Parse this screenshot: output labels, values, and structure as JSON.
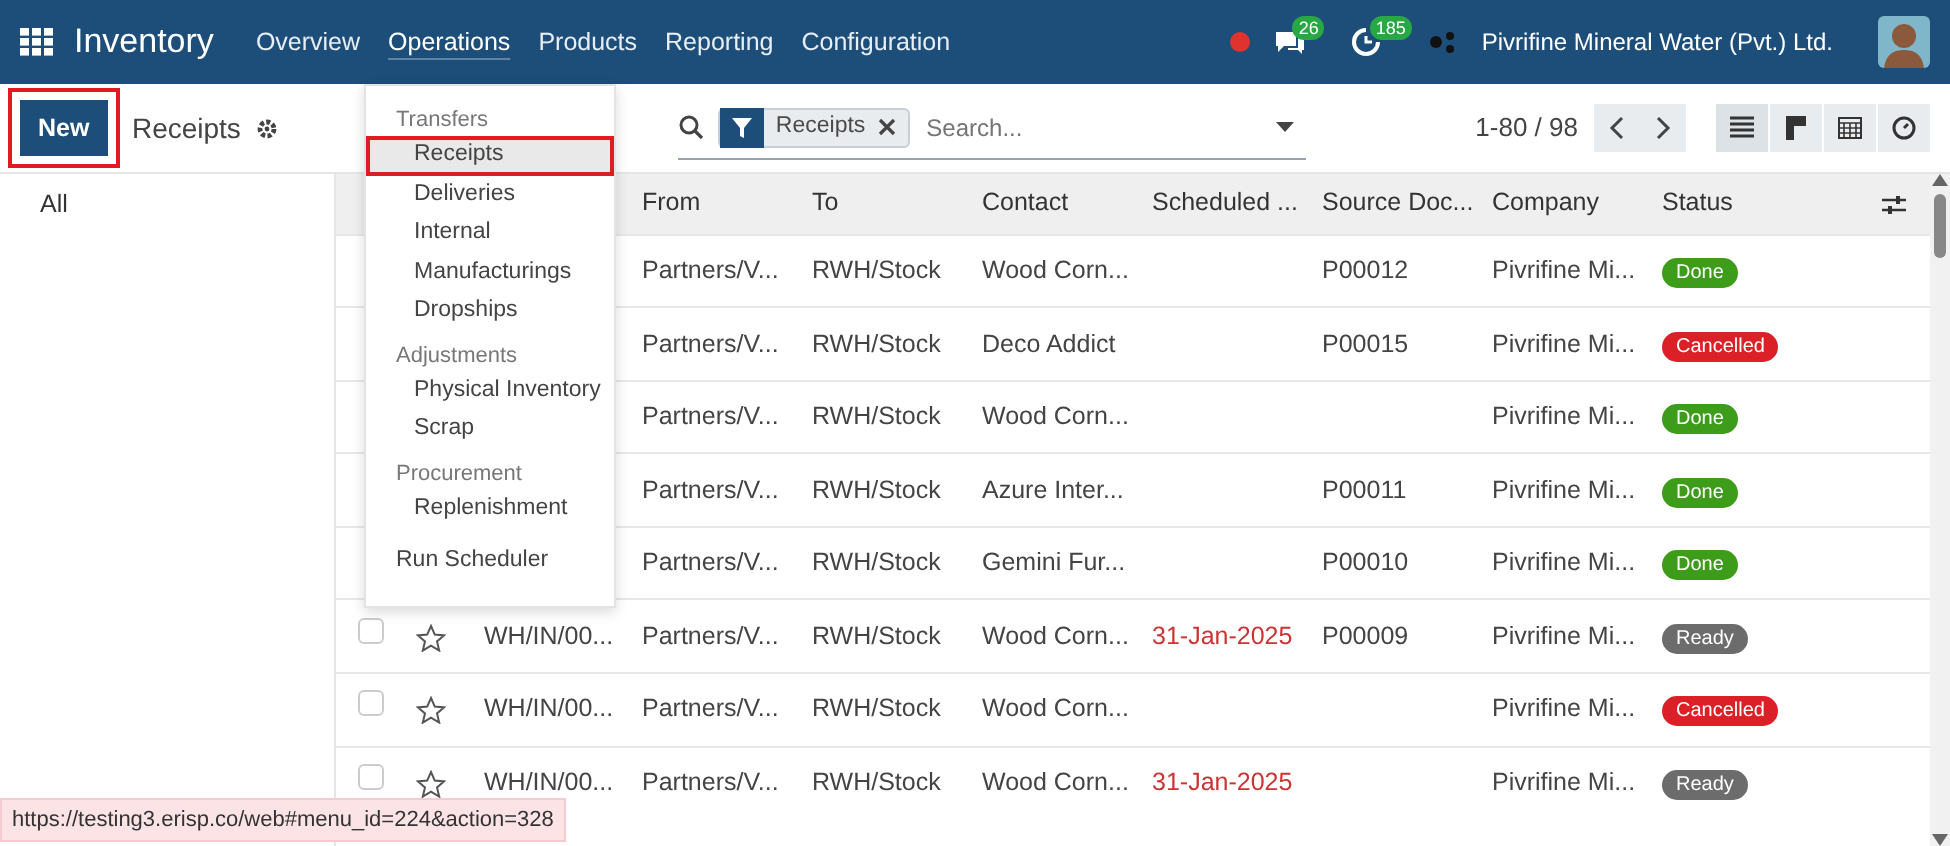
{
  "navbar": {
    "app_name": "Inventory",
    "menu": [
      {
        "label": "Overview",
        "open": false
      },
      {
        "label": "Operations",
        "open": true
      },
      {
        "label": "Products",
        "open": false
      },
      {
        "label": "Reporting",
        "open": false
      },
      {
        "label": "Configuration",
        "open": false
      }
    ],
    "messages_count": "26",
    "activities_count": "185",
    "company": "Pivrifine Mineral Water (Pvt.) Ltd."
  },
  "control_panel": {
    "new_button": {
      "label": "New",
      "highlighted": true
    },
    "breadcrumb": "Receipts",
    "search": {
      "facet": "Receipts",
      "placeholder": "Search..."
    },
    "pager": "1-80 / 98",
    "views": [
      {
        "kind": "list",
        "selected": true
      },
      {
        "kind": "kanban",
        "selected": false
      },
      {
        "kind": "calendar",
        "selected": false
      },
      {
        "kind": "activity",
        "selected": false
      }
    ]
  },
  "sidebar": {
    "items": [
      "All"
    ]
  },
  "dropdown": [
    {
      "kind": "header",
      "label": "Transfers"
    },
    {
      "kind": "item",
      "label": "Receipts",
      "selected": true,
      "highlighted": true
    },
    {
      "kind": "item",
      "label": "Deliveries",
      "selected": false,
      "highlighted": false
    },
    {
      "kind": "item",
      "label": "Internal",
      "selected": false,
      "highlighted": false
    },
    {
      "kind": "item",
      "label": "Manufacturings",
      "selected": false,
      "highlighted": false
    },
    {
      "kind": "item",
      "label": "Dropships",
      "selected": false,
      "highlighted": false
    },
    {
      "kind": "header",
      "label": "Adjustments"
    },
    {
      "kind": "item",
      "label": "Physical Inventory",
      "selected": false,
      "highlighted": false
    },
    {
      "kind": "item",
      "label": "Scrap",
      "selected": false,
      "highlighted": false
    },
    {
      "kind": "header",
      "label": "Procurement"
    },
    {
      "kind": "item",
      "label": "Replenishment",
      "selected": false,
      "highlighted": false
    },
    {
      "kind": "action",
      "label": "Run Scheduler"
    }
  ],
  "table": {
    "columns": [
      "From",
      "To",
      "Contact",
      "Scheduled ...",
      "Source Doc...",
      "Company",
      "Status"
    ],
    "rows": [
      {
        "from": "Partners/V...",
        "to": "RWH/Stock",
        "contact": "Wood Corn...",
        "scheduled": "",
        "source": "P00012",
        "company": "Pivrifine Mi...",
        "status": "Done",
        "color": "#3d9c19"
      },
      {
        "from": "Partners/V...",
        "to": "RWH/Stock",
        "contact": "Deco Addict",
        "scheduled": "",
        "source": "P00015",
        "company": "Pivrifine Mi...",
        "status": "Cancelled",
        "color": "#dc2027"
      },
      {
        "from": "Partners/V...",
        "to": "RWH/Stock",
        "contact": "Wood Corn...",
        "scheduled": "",
        "source": "",
        "company": "Pivrifine Mi...",
        "status": "Done",
        "color": "#3d9c19"
      },
      {
        "from": "Partners/V...",
        "to": "RWH/Stock",
        "contact": "Azure Inter...",
        "scheduled": "",
        "source": "P00011",
        "company": "Pivrifine Mi...",
        "status": "Done",
        "color": "#3d9c19"
      },
      {
        "from": "Partners/V...",
        "to": "RWH/Stock",
        "contact": "Gemini Fur...",
        "scheduled": "",
        "source": "P00010",
        "company": "Pivrifine Mi...",
        "status": "Done",
        "color": "#3d9c19"
      },
      {
        "reference": "WH/IN/00...",
        "checked": false,
        "starred": false,
        "from": "Partners/V...",
        "to": "RWH/Stock",
        "contact": "Wood Corn...",
        "scheduled": "31-Jan-2025",
        "source": "P00009",
        "company": "Pivrifine Mi...",
        "status": "Ready",
        "color": "#6c6c6c"
      },
      {
        "reference": "WH/IN/00...",
        "checked": false,
        "starred": false,
        "from": "Partners/V...",
        "to": "RWH/Stock",
        "contact": "Wood Corn...",
        "scheduled": "",
        "source": "",
        "company": "Pivrifine Mi...",
        "status": "Cancelled",
        "color": "#dc2027"
      },
      {
        "reference": "WH/IN/00...",
        "checked": false,
        "starred": false,
        "from": "Partners/V...",
        "to": "RWH/Stock",
        "contact": "Wood Corn...",
        "scheduled": "31-Jan-2025",
        "source": "",
        "company": "Pivrifine Mi...",
        "status": "Ready",
        "color": "#6c6c6c"
      }
    ]
  },
  "status_bar": {
    "url": "https://testing3.erisp.co/web#menu_id=224&action=328"
  }
}
